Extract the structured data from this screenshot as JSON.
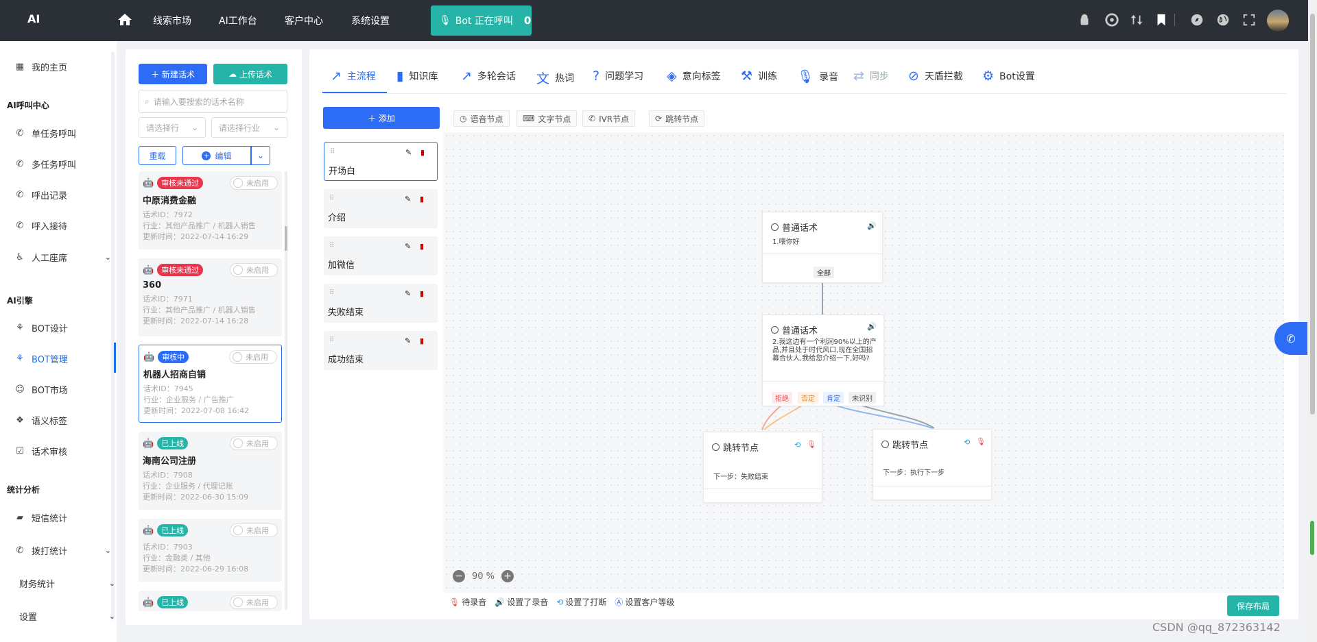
{
  "header": {
    "logo": "AI",
    "nav": [
      "线索市场",
      "AI工作台",
      "客户中心",
      "系统设置"
    ],
    "bot_status": "Bot 正在呼叫",
    "bot_count": "0"
  },
  "sidebar": {
    "home": "我的主页",
    "sections": [
      {
        "title": "AI呼叫中心",
        "items": [
          "单任务呼叫",
          "多任务呼叫",
          "呼出记录",
          "呼入接待",
          "人工座席"
        ]
      },
      {
        "title": "AI引擎",
        "items": [
          "BOT设计",
          "BOT管理",
          "BOT市场",
          "语义标签",
          "话术审核"
        ]
      },
      {
        "title": "统计分析",
        "items": [
          "短信统计",
          "拨打统计",
          "财务统计",
          "设置"
        ]
      }
    ],
    "active": "BOT管理"
  },
  "list": {
    "new_label": "新建话术",
    "upload_label": "上传话术",
    "search_placeholder": "请输入要搜索的话术名称",
    "select_trade": "请选择行",
    "select_industry": "请选择行业",
    "reload_label": "重载",
    "edit_label": "编辑",
    "toggle_label": "未启用",
    "cards": [
      {
        "status": "审核未通过",
        "title": "中原消费金融",
        "id": "话术ID：7972",
        "industry": "行业：其他产品推广 / 机器人销售",
        "updated": "更新时间：2022-07-14 16:29"
      },
      {
        "status": "审核未通过",
        "title": "360",
        "id": "话术ID：7971",
        "industry": "行业：其他产品推广 / 机器人销售",
        "updated": "更新时间：2022-07-14 16:28"
      },
      {
        "status": "审核中",
        "title": "机器人招商自销",
        "id": "话术ID：7945",
        "industry": "行业：企业服务 / 广告推广",
        "updated": "更新时间：2022-07-08 16:42"
      },
      {
        "status": "已上线",
        "title": "海南公司注册",
        "id": "话术ID：7908",
        "industry": "行业：企业服务 / 代理记账",
        "updated": "更新时间：2022-06-30 15:09"
      },
      {
        "status": "已上线",
        "title": "",
        "id": "话术ID：7903",
        "industry": "行业：金融类 / 其他",
        "updated": "更新时间：2022-06-29 16:08"
      },
      {
        "status": "已上线",
        "title": "",
        "id": "",
        "industry": "",
        "updated": ""
      }
    ]
  },
  "editor": {
    "tabs": [
      "主流程",
      "知识库",
      "多轮会话",
      "热词",
      "问题学习",
      "意向标签",
      "训练",
      "录音",
      "同步",
      "天盾拦截",
      "Bot设置"
    ],
    "add_label": "添加",
    "node_chips": [
      "语音节点",
      "文字节点",
      "IVR节点",
      "跳转节点"
    ],
    "flows": [
      "开场白",
      "介绍",
      "加微信",
      "失败结束",
      "成功结束"
    ],
    "nodes": {
      "n1": {
        "title": "普通话术",
        "body": "1.喂你好",
        "branch": "全部"
      },
      "n2": {
        "title": "普通话术",
        "body": "2.我这边有一个利润90%以上的产品,并且处于时代风口,现在全国招募合伙人,我给您介绍一下,好吗?",
        "branches": [
          "拒绝",
          "否定",
          "肯定",
          "未识别"
        ]
      },
      "n3": {
        "title": "跳转节点",
        "body": "下一步：失败结束"
      },
      "n4": {
        "title": "跳转节点",
        "body": "下一步：执行下一步"
      }
    },
    "zoom": "90 %",
    "legend": [
      "待录音",
      "设置了录音",
      "设置了打断",
      "设置客户等级"
    ],
    "save_label": "保存布局"
  },
  "watermark": "CSDN @qq_872363142",
  "colors": {
    "primary": "#2d6df5",
    "teal": "#26b4a8",
    "danger": "#e8364e",
    "topbar": "#2b2f36"
  }
}
